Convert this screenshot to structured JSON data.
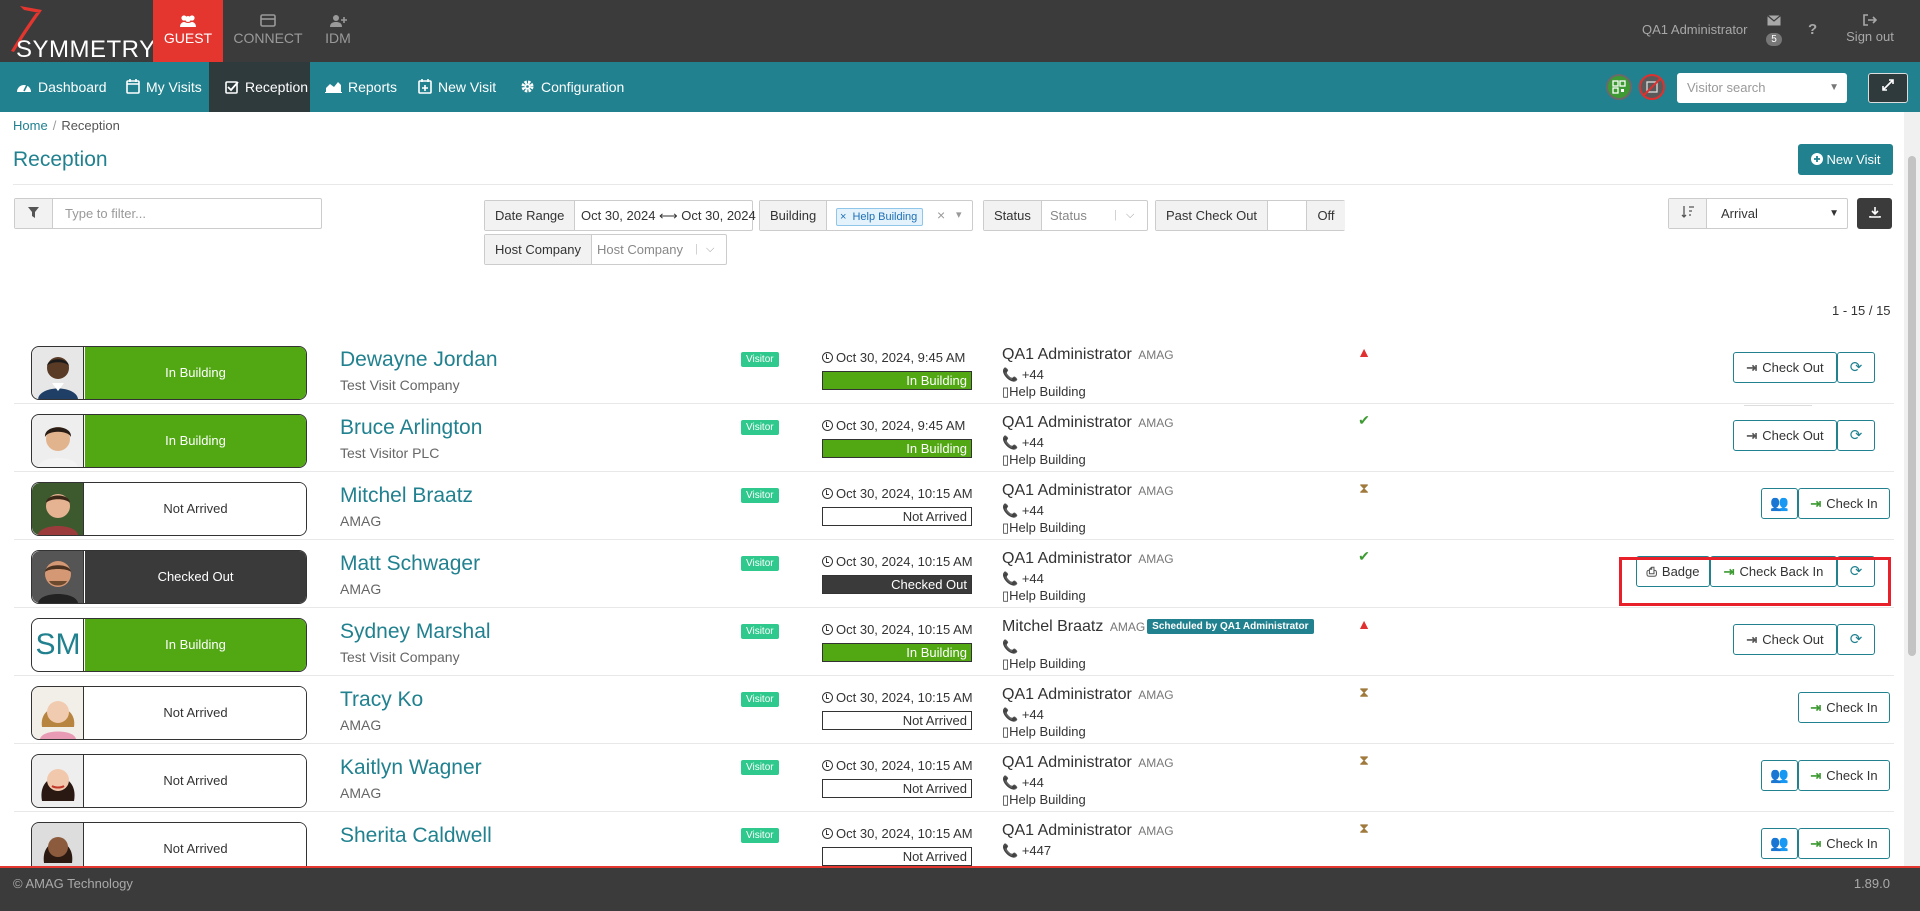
{
  "app": {
    "logo_text": "SYMMETRY",
    "logo_tm": "™",
    "tabs": [
      {
        "label": "GUEST",
        "active": true
      },
      {
        "label": "CONNECT",
        "active": false
      },
      {
        "label": "IDM",
        "active": false
      }
    ],
    "user": "QA1 Administrator",
    "mail_count": "5",
    "signout": "Sign out",
    "help": "?"
  },
  "nav": {
    "items": [
      {
        "label": "Dashboard"
      },
      {
        "label": "My Visits"
      },
      {
        "label": "Reception"
      },
      {
        "label": "Reports"
      },
      {
        "label": "New Visit"
      },
      {
        "label": "Configuration"
      }
    ],
    "visitor_search_placeholder": "Visitor search"
  },
  "breadcrumb": {
    "home": "Home",
    "current": "Reception"
  },
  "page": {
    "title": "Reception",
    "new_visit": "New Visit"
  },
  "filters": {
    "text_placeholder": "Type to filter...",
    "date_range_label": "Date Range",
    "date_range_value": "Oct 30, 2024 ⟷ Oct 30, 2024",
    "building_label": "Building",
    "building_tag": "Help Building",
    "status_label": "Status",
    "status_placeholder": "Status",
    "past_checkout_label": "Past Check Out",
    "past_checkout_value": "Off",
    "host_company_label": "Host Company",
    "host_company_placeholder": "Host Company",
    "sort_value": "Arrival"
  },
  "pager": "1 - 15 / 15",
  "visits": [
    {
      "status": "In Building",
      "tone": "green",
      "name": "Dewayne Jordan",
      "company": "Test Visit Company",
      "type": "Visitor",
      "time": "Oct 30, 2024, 9:45 AM",
      "host": "QA1 Administrator",
      "host_company": "AMAG",
      "phone": "+44",
      "building": "Help Building",
      "flag": "warn",
      "actions": [
        "Check Out"
      ]
    },
    {
      "status": "In Building",
      "tone": "green",
      "name": "Bruce Arlington",
      "company": "Test Visitor PLC",
      "type": "Visitor",
      "time": "Oct 30, 2024, 9:45 AM",
      "host": "QA1 Administrator",
      "host_company": "AMAG",
      "phone": "+44",
      "building": "Help Building",
      "flag": "ok",
      "actions": [
        "Check Out"
      ]
    },
    {
      "status": "Not Arrived",
      "tone": "white",
      "name": "Mitchel Braatz",
      "company": "AMAG",
      "type": "Visitor",
      "time": "Oct 30, 2024, 10:15 AM",
      "host": "QA1 Administrator",
      "host_company": "AMAG",
      "phone": "+44",
      "building": "Help Building",
      "flag": "wait",
      "actions": [
        "Check In"
      ]
    },
    {
      "status": "Checked Out",
      "tone": "dark",
      "name": "Matt Schwager",
      "company": "AMAG",
      "type": "Visitor",
      "time": "Oct 30, 2024, 10:15 AM",
      "host": "QA1 Administrator",
      "host_company": "AMAG",
      "phone": "+44",
      "building": "Help Building",
      "flag": "ok",
      "actions": [
        "Badge",
        "Check Back In"
      ]
    },
    {
      "status": "In Building",
      "tone": "green",
      "initials": "SM",
      "name": "Sydney Marshal",
      "company": "Test Visit Company",
      "type": "Visitor",
      "time": "Oct 30, 2024, 10:15 AM",
      "host": "Mitchel Braatz",
      "host_company": "AMAG",
      "scheduled": "Scheduled by QA1 Administrator",
      "phone": "",
      "building": "Help Building",
      "flag": "warn",
      "actions": [
        "Check Out"
      ]
    },
    {
      "status": "Not Arrived",
      "tone": "white",
      "name": "Tracy Ko",
      "company": "AMAG",
      "type": "Visitor",
      "time": "Oct 30, 2024, 10:15 AM",
      "host": "QA1 Administrator",
      "host_company": "AMAG",
      "phone": "+44",
      "building": "Help Building",
      "flag": "wait",
      "actions": [
        "Check In"
      ]
    },
    {
      "status": "Not Arrived",
      "tone": "white",
      "name": "Kaitlyn Wagner",
      "company": "AMAG",
      "type": "Visitor",
      "time": "Oct 30, 2024, 10:15 AM",
      "host": "QA1 Administrator",
      "host_company": "AMAG",
      "phone": "+44",
      "building": "Help Building",
      "flag": "wait",
      "actions": [
        "Check In"
      ]
    },
    {
      "status": "Not Arrived",
      "tone": "white",
      "name": "Sherita Caldwell",
      "company": "",
      "type": "Visitor",
      "time": "Oct 30, 2024, 10:15 AM",
      "host": "QA1 Administrator",
      "host_company": "AMAG",
      "phone": "+447",
      "building": "",
      "flag": "wait",
      "actions": [
        "Check In"
      ]
    }
  ],
  "footer": {
    "copyright": "© AMAG Technology",
    "version": "1.89.0"
  },
  "colors": {
    "brand": "#21818f",
    "accent": "#e4362f",
    "in_building": "#51a813",
    "checked_out": "#3a3a3a"
  }
}
